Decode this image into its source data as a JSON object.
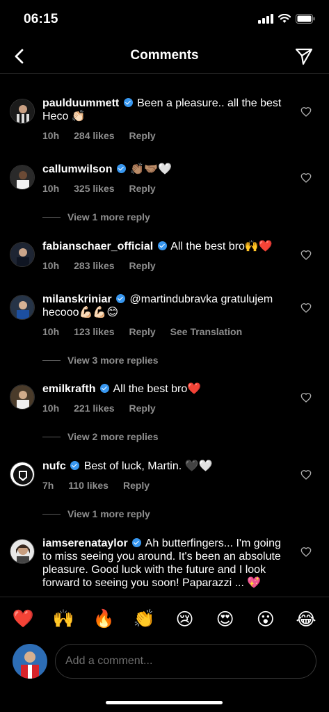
{
  "status": {
    "time": "06:15"
  },
  "nav": {
    "title": "Comments",
    "back_icon": "chevron-left-icon",
    "send_icon": "paper-plane-icon"
  },
  "comments": [
    {
      "username": "paulduummett",
      "text": "Been a pleasure.. all the best Heco 👏🏻",
      "time": "10h",
      "likes": "284 likes",
      "reply": "Reply"
    },
    {
      "username": "callumwilson",
      "text": "👏🏽🤝🏽🤍",
      "time": "10h",
      "likes": "325 likes",
      "reply": "Reply",
      "more_replies": "View 1 more reply"
    },
    {
      "username": "fabianschaer_official",
      "text": "All the best bro🙌❤️",
      "time": "10h",
      "likes": "283 likes",
      "reply": "Reply"
    },
    {
      "username": "milanskriniar",
      "text": "@martindubravka gratulujem hecooo💪🏻💪🏻😊",
      "time": "10h",
      "likes": "123 likes",
      "reply": "Reply",
      "translate": "See Translation",
      "more_replies": "View 3 more replies"
    },
    {
      "username": "emilkrafth",
      "text": "All the best bro❤️",
      "time": "10h",
      "likes": "221 likes",
      "reply": "Reply",
      "more_replies": "View 2 more replies"
    },
    {
      "username": "nufc",
      "text": "Best of luck, Martin. 🖤🤍",
      "time": "7h",
      "likes": "110 likes",
      "reply": "Reply",
      "more_replies": "View 1 more reply"
    },
    {
      "username": "iamserenataylor",
      "text": "Ah butterfingers... I'm going to miss seeing you around. It's been an absolute pleasure. Good luck with the future and I look forward to seeing you soon! Paparazzi ... 💖"
    }
  ],
  "emoji_bar": [
    "❤️",
    "🙌",
    "🔥",
    "👏",
    "😢",
    "😍",
    "😮",
    "😂"
  ],
  "composer": {
    "placeholder": "Add a comment..."
  }
}
